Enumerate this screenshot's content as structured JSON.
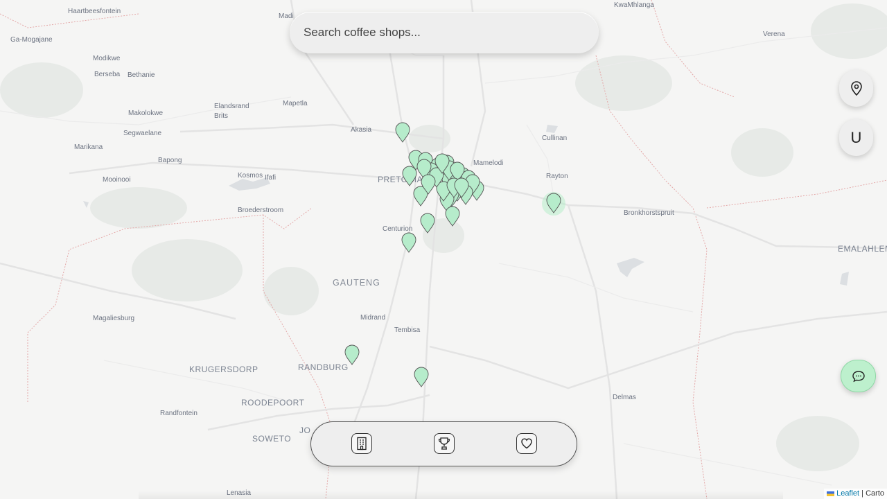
{
  "search": {
    "placeholder": "Search coffee shops..."
  },
  "controls": {
    "locate_icon": "map-pin-icon",
    "underline_icon": "U",
    "chat_icon": "chat-bubble-icon"
  },
  "dock": {
    "icons": [
      "building-icon",
      "trophy-icon",
      "heart-icon"
    ]
  },
  "attribution": {
    "leaflet": "Leaflet",
    "sep": "|",
    "provider": "Carto"
  },
  "colors": {
    "marker_fill": "#b6eccb",
    "marker_stroke": "#555555",
    "chat_bg": "#bdf0cd"
  },
  "places": [
    {
      "name": "Haartbeesfontein"
    },
    {
      "name": "Madi"
    },
    {
      "name": "KwaMhlanga"
    },
    {
      "name": "Ga-Mogajane"
    },
    {
      "name": "Verena"
    },
    {
      "name": "Modikwe"
    },
    {
      "name": "Berseba"
    },
    {
      "name": "Bethanie"
    },
    {
      "name": "Elandsrand"
    },
    {
      "name": "Brits"
    },
    {
      "name": "Mapetla"
    },
    {
      "name": "Makolokwe"
    },
    {
      "name": "Segwaelane"
    },
    {
      "name": "Akasia"
    },
    {
      "name": "Cullinan"
    },
    {
      "name": "Marikana"
    },
    {
      "name": "Bapong"
    },
    {
      "name": "Mamelodi"
    },
    {
      "name": "Kosmos"
    },
    {
      "name": "Ifafi"
    },
    {
      "name": "Rayton"
    },
    {
      "name": "Mooinooi"
    },
    {
      "name": "PRETORIA"
    },
    {
      "name": "Broederstroom"
    },
    {
      "name": "Bronkhorstspruit"
    },
    {
      "name": "Centurion"
    },
    {
      "name": "EMALAHLENI"
    },
    {
      "name": "GAUTENG"
    },
    {
      "name": "Magaliesburg"
    },
    {
      "name": "Midrand"
    },
    {
      "name": "Tembisa"
    },
    {
      "name": "RANDBURG"
    },
    {
      "name": "KRUGERSDORP"
    },
    {
      "name": "Delmas"
    },
    {
      "name": "ROODEPOORT"
    },
    {
      "name": "Randfontein"
    },
    {
      "name": "SOWETO"
    },
    {
      "name": "JO"
    },
    {
      "name": "Lenasia"
    }
  ]
}
